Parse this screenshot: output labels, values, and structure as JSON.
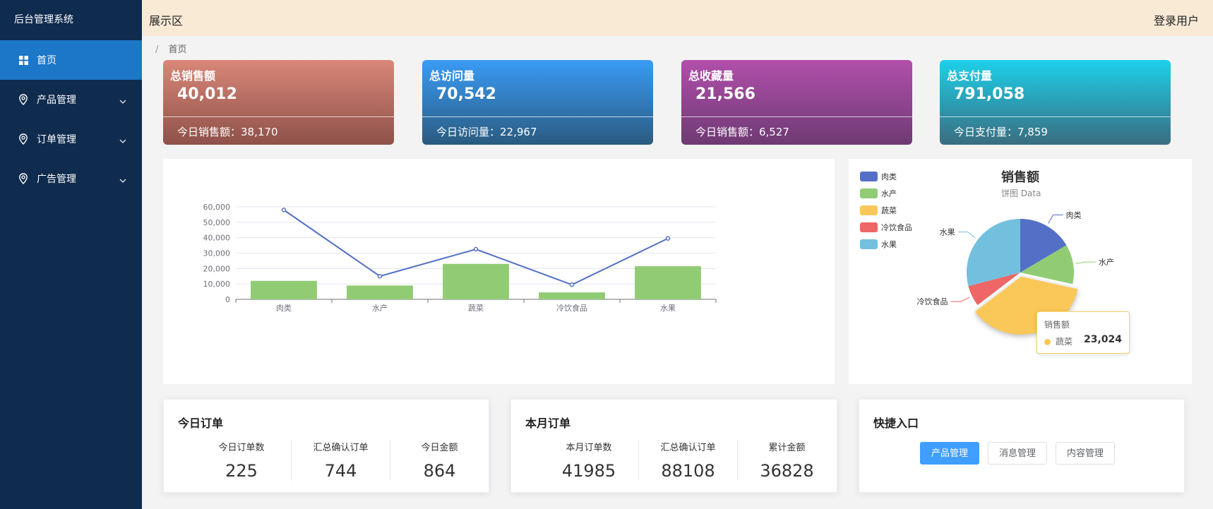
{
  "sidebar": {
    "logo": "后台管理系统",
    "items": [
      {
        "label": "首页",
        "icon": "grid-icon",
        "active": true
      },
      {
        "label": "产品管理",
        "icon": "location-pin-icon"
      },
      {
        "label": "订单管理",
        "icon": "location-pin-icon"
      },
      {
        "label": "广告管理",
        "icon": "location-pin-icon"
      }
    ]
  },
  "header": {
    "title": "展示区",
    "user": "登录用户"
  },
  "breadcrumb": {
    "sep": "/",
    "current": "首页"
  },
  "stats": [
    {
      "title": "总销售额",
      "value": "40,012",
      "foot": "今日销售额：38,170"
    },
    {
      "title": "总访问量",
      "value": "70,542",
      "foot": "今日访问量：22,967"
    },
    {
      "title": "总收藏量",
      "value": "21,566",
      "foot": "今日销售额：6,527"
    },
    {
      "title": "总支付量",
      "value": "791,058",
      "foot": "今日支付量：7,859"
    }
  ],
  "chart_data": [
    {
      "type": "bar",
      "categories": [
        "肉类",
        "水产",
        "蔬菜",
        "冷饮食品",
        "水果"
      ],
      "series": [
        {
          "type": "bar",
          "values": [
            12000,
            9000,
            23000,
            4500,
            21500
          ],
          "color": "#91cc75"
        },
        {
          "type": "line",
          "values": [
            58000,
            15000,
            32500,
            9500,
            39500
          ],
          "color": "#5470c6"
        }
      ],
      "ylim": [
        0,
        60000
      ],
      "yticks": [
        "0",
        "10,000",
        "20,000",
        "30,000",
        "40,000",
        "50,000",
        "60,000"
      ],
      "grid": true
    },
    {
      "type": "pie",
      "title": "销售额",
      "subtitle": "饼图 Data",
      "legend_position": "top-left",
      "slices": [
        {
          "name": "肉类",
          "value": 10500,
          "color": "#5470c6"
        },
        {
          "name": "水产",
          "value": 7600,
          "color": "#91cc75"
        },
        {
          "name": "蔬菜",
          "value": 23024,
          "color": "#fac858"
        },
        {
          "name": "冷饮食品",
          "value": 4000,
          "color": "#ee6666"
        },
        {
          "name": "水果",
          "value": 18500,
          "color": "#73c0de"
        }
      ],
      "tooltip": {
        "series": "销售额",
        "name": "蔬菜",
        "value": "23,024"
      }
    }
  ],
  "orders": {
    "today": {
      "title": "今日订单",
      "cols": [
        {
          "label": "今日订单数",
          "value": "225"
        },
        {
          "label": "汇总确认订单",
          "value": "744"
        },
        {
          "label": "今日金额",
          "value": "864"
        }
      ]
    },
    "month": {
      "title": "本月订单",
      "cols": [
        {
          "label": "本月订单数",
          "value": "41985"
        },
        {
          "label": "汇总确认订单",
          "value": "88108"
        },
        {
          "label": "累计金额",
          "value": "36828"
        }
      ]
    }
  },
  "quick": {
    "title": "快捷入口",
    "buttons": [
      "产品管理",
      "消息管理",
      "内容管理"
    ]
  }
}
